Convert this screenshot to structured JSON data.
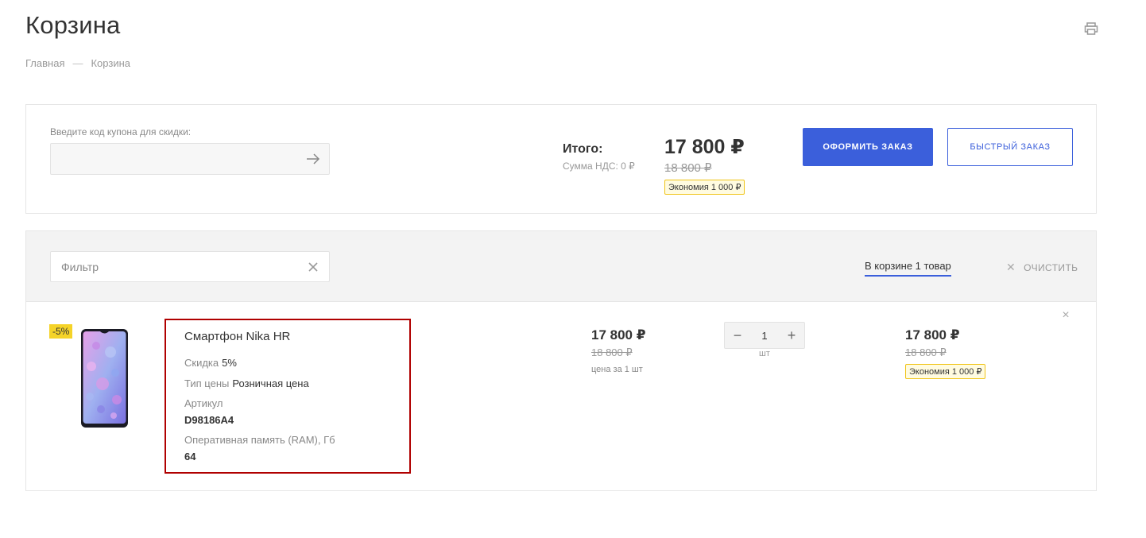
{
  "page": {
    "title": "Корзина",
    "print_icon": "printer-icon"
  },
  "breadcrumb": {
    "home": "Главная",
    "separator": "—",
    "current": "Корзина"
  },
  "summary": {
    "coupon_label": "Введите код купона для скидки:",
    "coupon_value": "",
    "coupon_submit_icon": "arrow-right-icon",
    "total_label": "Итого:",
    "vat_text": "Сумма НДС: 0 ₽",
    "total_price": "17 800 ₽",
    "total_old_price": "18 800 ₽",
    "economy": "Экономия 1 000 ₽",
    "order_button": "ОФОРМИТЬ ЗАКАЗ",
    "quick_order_button": "БЫСТРЫЙ ЗАКАЗ"
  },
  "cart": {
    "filter_placeholder": "Фильтр",
    "filter_clear_icon": "close-icon",
    "in_cart_text": "В корзине 1 товар",
    "clear_label": "ОЧИСТИТЬ",
    "items": [
      {
        "discount_badge": "-5%",
        "name_prefix": "Смартфон",
        "name_model": "Nika HR",
        "props": [
          {
            "label": "Скидка",
            "value": "5%"
          },
          {
            "label": "Тип цены",
            "value": "Розничная цена"
          }
        ],
        "article_label": "Артикул",
        "article_value": "D98186A4",
        "ram_label": "Оперативная память (RAM), Гб",
        "ram_value": "64",
        "unit_price": "17 800 ₽",
        "unit_old_price": "18 800 ₽",
        "unit_note": "цена за 1 шт",
        "quantity": "1",
        "quantity_unit": "шт",
        "sum_price": "17 800 ₽",
        "sum_old_price": "18 800 ₽",
        "economy": "Экономия 1 000 ₽",
        "remove_icon": "close-icon"
      }
    ]
  },
  "colors": {
    "accent": "#3b5fdb",
    "badge_yellow": "#f5d328",
    "highlight_border": "#b00000"
  }
}
